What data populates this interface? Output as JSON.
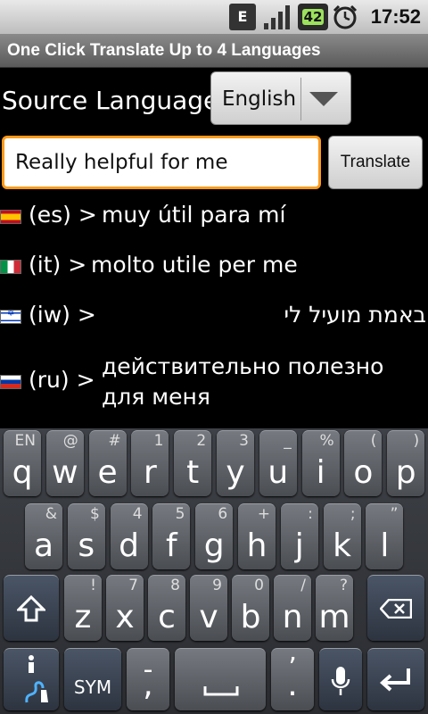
{
  "status_bar": {
    "network": "E",
    "battery": "42",
    "time": "17:52"
  },
  "title": "One Click Translate Up to 4 Languages",
  "source": {
    "label": "Source Language",
    "selected": "English"
  },
  "input": {
    "value": "Really helpful for me"
  },
  "translate_label": "Translate",
  "results": [
    {
      "flag": "spain-flag-icon",
      "code": "(es) >",
      "text": "muy útil para mí"
    },
    {
      "flag": "italy-flag-icon",
      "code": "(it) >",
      "text": "molto utile per me"
    },
    {
      "flag": "israel-flag-icon",
      "code": "(iw) >",
      "text": "באמת מועיל לי"
    },
    {
      "flag": "russia-flag-icon",
      "code": "(ru) >",
      "text": "действительно полезно для меня"
    }
  ],
  "keyboard": {
    "row1": [
      {
        "main": "q",
        "alt": "EN"
      },
      {
        "main": "w",
        "alt": "@"
      },
      {
        "main": "e",
        "alt": "#"
      },
      {
        "main": "r",
        "alt": "1"
      },
      {
        "main": "t",
        "alt": "2"
      },
      {
        "main": "y",
        "alt": "3"
      },
      {
        "main": "u",
        "alt": "_"
      },
      {
        "main": "i",
        "alt": "%"
      },
      {
        "main": "o",
        "alt": "("
      },
      {
        "main": "p",
        "alt": ")"
      }
    ],
    "row2": [
      {
        "main": "a",
        "alt": "&"
      },
      {
        "main": "s",
        "alt": "$"
      },
      {
        "main": "d",
        "alt": "4"
      },
      {
        "main": "f",
        "alt": "5"
      },
      {
        "main": "g",
        "alt": "6"
      },
      {
        "main": "h",
        "alt": "+"
      },
      {
        "main": "j",
        "alt": ":"
      },
      {
        "main": "k",
        "alt": ";"
      },
      {
        "main": "l",
        "alt": "”"
      }
    ],
    "row3": [
      {
        "main": "z",
        "alt": "!"
      },
      {
        "main": "x",
        "alt": "7"
      },
      {
        "main": "c",
        "alt": "8"
      },
      {
        "main": "v",
        "alt": "9"
      },
      {
        "main": "b",
        "alt": "0"
      },
      {
        "main": "n",
        "alt": "/"
      },
      {
        "main": "m",
        "alt": "?"
      }
    ],
    "sym_label": "SYM",
    "comma_main": ",",
    "comma_alt": "-",
    "period_main": ".",
    "period_alt": "’"
  }
}
